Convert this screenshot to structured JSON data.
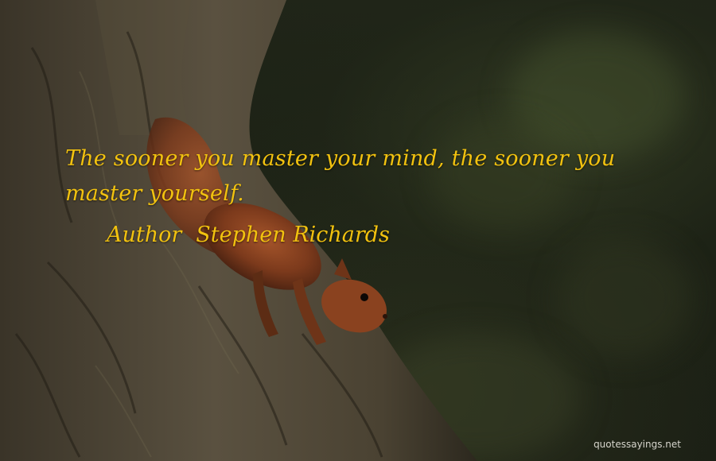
{
  "quote": {
    "text": "The sooner you master your mind, the sooner you master yourself.",
    "author_label": "Author",
    "author_name": "Stephen Richards",
    "text_color": "#f2c20f"
  },
  "watermark": {
    "text": "quotessayings.net"
  },
  "background": {
    "subject": "squirrel on tree trunk",
    "tones": [
      "#1a1e14",
      "#3f4a2c",
      "#5a4a34",
      "#7a3a1c"
    ]
  }
}
